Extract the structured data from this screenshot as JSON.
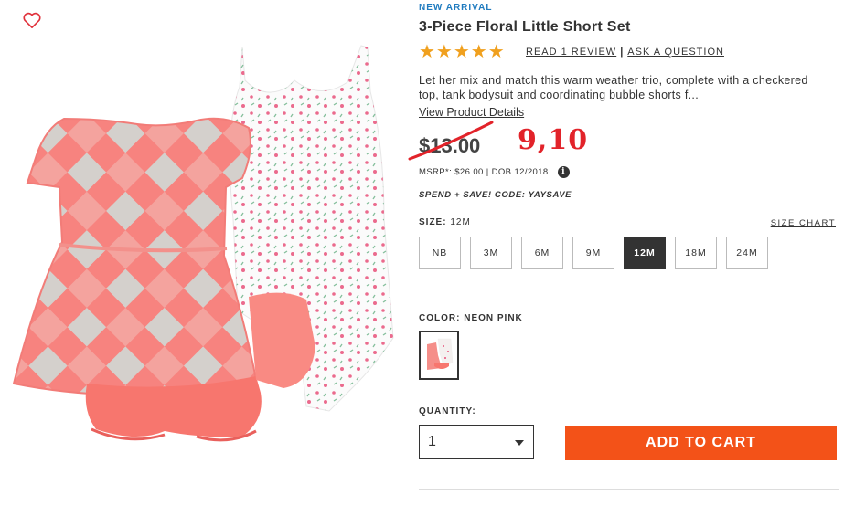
{
  "product": {
    "badge": "NEW ARRIVAL",
    "title": "3-Piece Floral Little Short Set",
    "rating_stars": 5,
    "stars_text": "★★★★★",
    "read_reviews": "READ 1 REVIEW",
    "review_separator": "|",
    "ask_question": "ASK A QUESTION",
    "description": "Let her mix and match this warm weather trio, complete with a checkered top, tank bodysuit and coordinating bubble shorts f...",
    "details_link": "View Product Details",
    "price": "$13.00",
    "handwritten_price": "9,10",
    "msrp": "MSRP*: $26.00 | DOB 12/2018",
    "info_icon_glyph": "i",
    "promo": "SPEND + SAVE! CODE: YAYSAVE"
  },
  "size": {
    "label": "SIZE:",
    "selected": "12M",
    "chart_link": "SIZE CHART",
    "options": [
      "NB",
      "3M",
      "6M",
      "9M",
      "12M",
      "18M",
      "24M"
    ]
  },
  "color": {
    "label": "COLOR: NEON PINK"
  },
  "quantity": {
    "label": "QUANTITY:",
    "value": "1"
  },
  "cart": {
    "add_label": "ADD TO CART"
  },
  "colors": {
    "accent": "#f35218",
    "star": "#f0a01e",
    "badge": "#1f7bbf",
    "annotation": "#e2232a"
  },
  "icons": {
    "wishlist": "heart-icon",
    "info": "info-icon",
    "dropdown": "chevron-down-icon"
  }
}
